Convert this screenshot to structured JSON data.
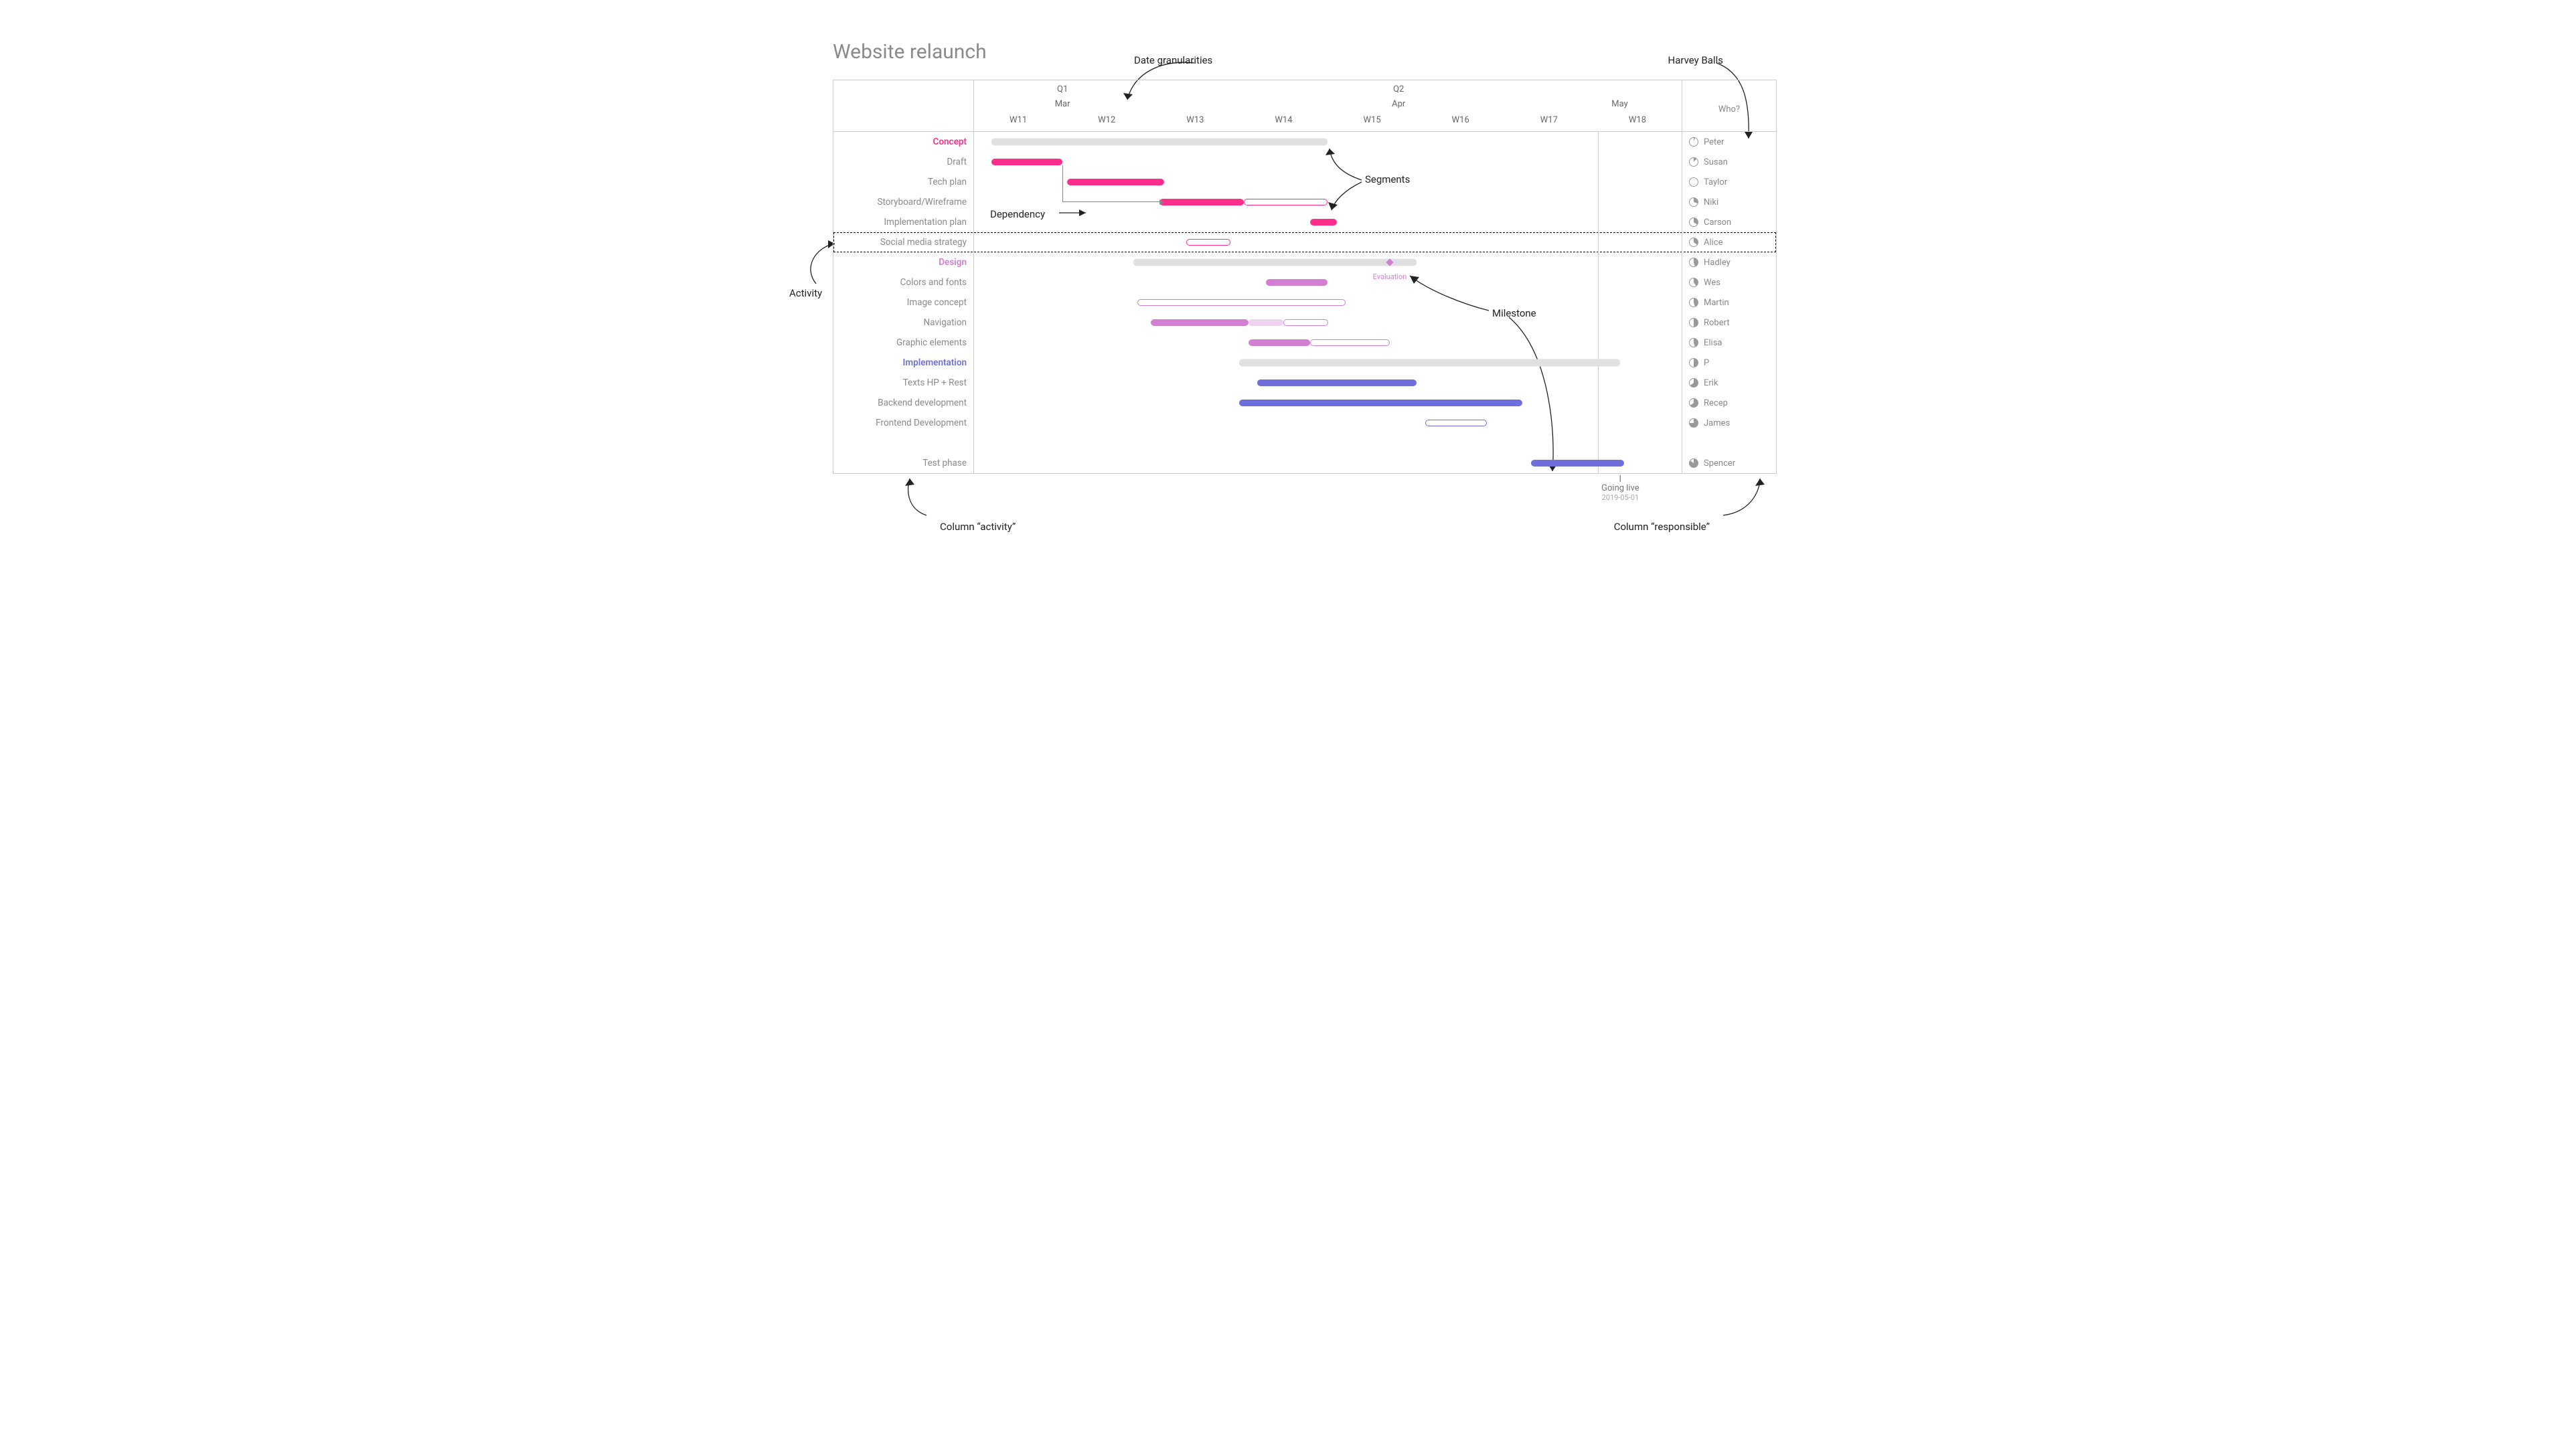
{
  "title": "Website relaunch",
  "annotations": {
    "date_granularities": "Date granularities",
    "harvey_balls": "Harvey Balls",
    "segments": "Segments",
    "dependency": "Dependency",
    "activity": "Activity",
    "milestone": "Milestone",
    "col_activity": "Column “activity”",
    "col_responsible": "Column “responsible”"
  },
  "header": {
    "quarters": [
      {
        "label": "Q1",
        "center_week": 12
      },
      {
        "label": "Q2",
        "center_week": 15.8
      }
    ],
    "months": [
      {
        "label": "Mar",
        "center_week": 12
      },
      {
        "label": "Apr",
        "center_week": 15.8
      },
      {
        "label": "May",
        "center_week": 18.3
      }
    ],
    "weeks": [
      "W11",
      "W12",
      "W13",
      "W14",
      "W15",
      "W16",
      "W17",
      "W18"
    ],
    "week_start": 11,
    "week_end": 19,
    "who_header": "Who?"
  },
  "golive": {
    "label": "Going live",
    "date": "2019-05-01",
    "week": 18.3
  },
  "rows": [
    {
      "id": "concept",
      "label": "Concept",
      "category": true,
      "color": "pink",
      "bars": [
        {
          "type": "summary",
          "start": 11.2,
          "end": 15.0
        }
      ],
      "who": "Peter",
      "progress": 5
    },
    {
      "id": "draft",
      "label": "Draft",
      "color": "pink",
      "bars": [
        {
          "type": "solid",
          "start": 11.2,
          "end": 12.0
        }
      ],
      "who": "Susan",
      "progress": 12
    },
    {
      "id": "techplan",
      "label": "Tech plan",
      "color": "pink",
      "bars": [
        {
          "type": "solid",
          "start": 12.05,
          "end": 13.15
        }
      ],
      "who": "Taylor",
      "progress": 0
    },
    {
      "id": "storyboard",
      "label": "Storyboard/Wireframe",
      "color": "pink",
      "bars": [
        {
          "type": "solid",
          "start": 13.1,
          "end": 14.05
        },
        {
          "type": "outline",
          "start": 14.05,
          "end": 15.0
        }
      ],
      "who": "Niki",
      "progress": 30
    },
    {
      "id": "implplan",
      "label": "Implementation plan",
      "color": "pink",
      "bars": [
        {
          "type": "solid",
          "start": 14.8,
          "end": 15.1
        }
      ],
      "who": "Carson",
      "progress": 35
    },
    {
      "id": "social",
      "label": "Social media strategy",
      "color": "pink",
      "selected": true,
      "bars": [
        {
          "type": "outline",
          "start": 13.4,
          "end": 13.9
        }
      ],
      "who": "Alice",
      "progress": 35
    },
    {
      "id": "design",
      "label": "Design",
      "category": true,
      "color": "violet",
      "bars": [
        {
          "type": "summary",
          "start": 12.8,
          "end": 16.0
        }
      ],
      "milestone": {
        "week": 15.7,
        "label": "Evaluation"
      },
      "who": "Hadley",
      "progress": 45
    },
    {
      "id": "colors",
      "label": "Colors and fonts",
      "color": "violet",
      "bars": [
        {
          "type": "solid",
          "start": 14.3,
          "end": 15.0
        }
      ],
      "who": "Wes",
      "progress": 40
    },
    {
      "id": "imgconcept",
      "label": "Image concept",
      "color": "violet",
      "bars": [
        {
          "type": "outline",
          "start": 12.85,
          "end": 15.2
        }
      ],
      "who": "Martin",
      "progress": 45
    },
    {
      "id": "nav",
      "label": "Navigation",
      "color": "violet",
      "bars": [
        {
          "type": "solid",
          "start": 13.0,
          "end": 14.1
        },
        {
          "type": "light",
          "start": 14.1,
          "end": 14.5
        },
        {
          "type": "outline",
          "start": 14.5,
          "end": 15.0
        }
      ],
      "who": "Robert",
      "progress": 50
    },
    {
      "id": "graphic",
      "label": "Graphic elements",
      "color": "violet",
      "bars": [
        {
          "type": "solid",
          "start": 14.1,
          "end": 14.8
        },
        {
          "type": "outline",
          "start": 14.8,
          "end": 15.7
        }
      ],
      "who": "Elisa",
      "progress": 45
    },
    {
      "id": "impl",
      "label": "Implementation",
      "category": true,
      "color": "blue",
      "bars": [
        {
          "type": "summary",
          "start": 14.0,
          "end": 18.3
        }
      ],
      "who": "P",
      "progress": 50
    },
    {
      "id": "texts",
      "label": "Texts HP + Rest",
      "color": "blue",
      "bars": [
        {
          "type": "solid",
          "start": 14.2,
          "end": 16.0
        }
      ],
      "who": "Erik",
      "progress": 65
    },
    {
      "id": "backend",
      "label": "Backend development",
      "color": "blue",
      "bars": [
        {
          "type": "solid",
          "start": 14.0,
          "end": 17.2
        }
      ],
      "who": "Recep",
      "progress": 65
    },
    {
      "id": "frontend",
      "label": "Frontend Development",
      "color": "blue",
      "bars": [
        {
          "type": "outline",
          "start": 16.1,
          "end": 16.8
        }
      ],
      "who": "James",
      "progress": 75
    },
    {
      "id": "spacer",
      "label": "",
      "spacer": true
    },
    {
      "id": "test",
      "label": "Test phase",
      "color": "blue",
      "bars": [
        {
          "type": "solid",
          "start": 17.3,
          "end": 18.35
        }
      ],
      "who": "Spencer",
      "progress": 85
    }
  ],
  "chart_data": {
    "type": "gantt",
    "title": "Website relaunch",
    "x_unit": "ISO week number (2019)",
    "x_range": [
      11,
      19
    ],
    "x_ticks_weeks": [
      "W11",
      "W12",
      "W13",
      "W14",
      "W15",
      "W16",
      "W17",
      "W18"
    ],
    "x_ticks_months": [
      "Mar",
      "Apr",
      "May"
    ],
    "x_ticks_quarters": [
      "Q1",
      "Q2"
    ],
    "milestones": [
      {
        "label": "Evaluation",
        "week": 15.7,
        "group": "Design"
      },
      {
        "label": "Going live",
        "date": "2019-05-01",
        "week": 18.3
      }
    ],
    "dependencies": [
      {
        "from": "Draft",
        "to": "Storyboard/Wireframe"
      }
    ],
    "tasks": [
      {
        "group": null,
        "name": "Concept",
        "type": "group-summary",
        "start": 11.2,
        "end": 15.0,
        "responsible": "Peter",
        "progress_pct": 5
      },
      {
        "group": "Concept",
        "name": "Draft",
        "start": 11.2,
        "end": 12.0,
        "responsible": "Susan",
        "progress_pct": 12
      },
      {
        "group": "Concept",
        "name": "Tech plan",
        "start": 12.05,
        "end": 13.15,
        "responsible": "Taylor",
        "progress_pct": 0
      },
      {
        "group": "Concept",
        "name": "Storyboard/Wireframe",
        "segments": [
          [
            13.1,
            14.05,
            "done"
          ],
          [
            14.05,
            15.0,
            "planned"
          ]
        ],
        "responsible": "Niki",
        "progress_pct": 30
      },
      {
        "group": "Concept",
        "name": "Implementation plan",
        "start": 14.8,
        "end": 15.1,
        "responsible": "Carson",
        "progress_pct": 35
      },
      {
        "group": "Concept",
        "name": "Social media strategy",
        "start": 13.4,
        "end": 13.9,
        "state": "planned",
        "responsible": "Alice",
        "progress_pct": 35
      },
      {
        "group": null,
        "name": "Design",
        "type": "group-summary",
        "start": 12.8,
        "end": 16.0,
        "responsible": "Hadley",
        "progress_pct": 45
      },
      {
        "group": "Design",
        "name": "Colors and fonts",
        "start": 14.3,
        "end": 15.0,
        "responsible": "Wes",
        "progress_pct": 40
      },
      {
        "group": "Design",
        "name": "Image concept",
        "start": 12.85,
        "end": 15.2,
        "state": "planned",
        "responsible": "Martin",
        "progress_pct": 45
      },
      {
        "group": "Design",
        "name": "Navigation",
        "segments": [
          [
            13.0,
            14.1,
            "done"
          ],
          [
            14.1,
            14.5,
            "partial"
          ],
          [
            14.5,
            15.0,
            "planned"
          ]
        ],
        "responsible": "Robert",
        "progress_pct": 50
      },
      {
        "group": "Design",
        "name": "Graphic elements",
        "segments": [
          [
            14.1,
            14.8,
            "done"
          ],
          [
            14.8,
            15.7,
            "planned"
          ]
        ],
        "responsible": "Elisa",
        "progress_pct": 45
      },
      {
        "group": null,
        "name": "Implementation",
        "type": "group-summary",
        "start": 14.0,
        "end": 18.3,
        "responsible": "P",
        "progress_pct": 50
      },
      {
        "group": "Implementation",
        "name": "Texts HP + Rest",
        "start": 14.2,
        "end": 16.0,
        "responsible": "Erik",
        "progress_pct": 65
      },
      {
        "group": "Implementation",
        "name": "Backend development",
        "start": 14.0,
        "end": 17.2,
        "responsible": "Recep",
        "progress_pct": 65
      },
      {
        "group": "Implementation",
        "name": "Frontend Development",
        "start": 16.1,
        "end": 16.8,
        "state": "planned",
        "responsible": "James",
        "progress_pct": 75
      },
      {
        "group": "Implementation",
        "name": "Test phase",
        "start": 17.3,
        "end": 18.35,
        "responsible": "Spencer",
        "progress_pct": 85
      }
    ],
    "right_column": {
      "header": "Who?",
      "semantics": "responsible person + Harvey-ball progress"
    }
  }
}
